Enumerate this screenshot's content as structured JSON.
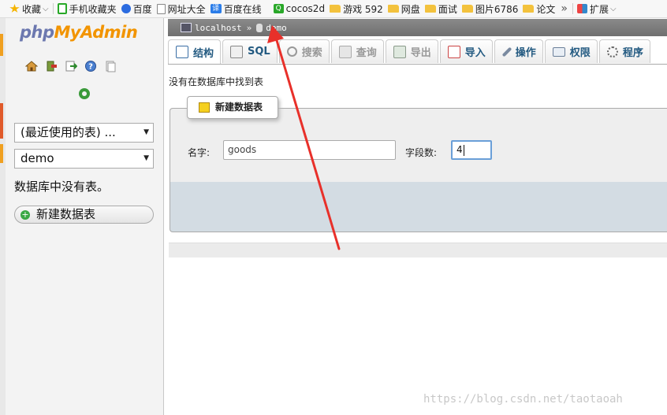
{
  "browser": {
    "bookmarks": [
      {
        "label": "收藏",
        "icon": "star-icon",
        "chevron": "⌵"
      },
      {
        "label": "手机收藏夹",
        "icon": "phone-icon"
      },
      {
        "label": "百度",
        "icon": "baidu-paw-icon"
      },
      {
        "label": "网址大全",
        "icon": "page-icon"
      },
      {
        "label": "百度在线",
        "icon": "translate-icon",
        "glyph": "译"
      },
      {
        "label": "cocos2d",
        "icon": "search-icon",
        "glyph": "Q"
      },
      {
        "label": "游戏 592",
        "icon": "folder-icon"
      },
      {
        "label": "网盘",
        "icon": "folder-icon"
      },
      {
        "label": "面试",
        "icon": "folder-icon"
      },
      {
        "label": "图片6786",
        "icon": "folder-icon"
      },
      {
        "label": "论文",
        "icon": "folder-icon"
      }
    ],
    "overflow": "»",
    "extensions_label": "扩展",
    "extensions_chevron": "⌵"
  },
  "sidebar": {
    "logo_php": "php",
    "logo_myadmin": "MyAdmin",
    "nav_icons": [
      "home-icon",
      "logout-icon",
      "sql-query-icon",
      "help-icon",
      "docs-icon"
    ],
    "reload_icon": "reload-icon",
    "recent_tables": "(最近使用的表) ...",
    "database_select": "demo",
    "no_tables_text": "数据库中没有表。",
    "new_table_button": "新建数据表",
    "new_table_glyph": "+"
  },
  "breadcrumb": {
    "server": "localhost",
    "separator": "»",
    "database": "demo"
  },
  "tabs": [
    {
      "label": "结构",
      "icon": "structure-icon",
      "state": "active"
    },
    {
      "label": "SQL",
      "icon": "sql-icon",
      "state": "normal"
    },
    {
      "label": "搜索",
      "icon": "search-icon",
      "state": "disabled"
    },
    {
      "label": "查询",
      "icon": "query-icon",
      "state": "disabled"
    },
    {
      "label": "导出",
      "icon": "export-icon",
      "state": "disabled"
    },
    {
      "label": "导入",
      "icon": "import-icon",
      "state": "normal"
    },
    {
      "label": "操作",
      "icon": "wrench-icon",
      "state": "normal"
    },
    {
      "label": "权限",
      "icon": "privileges-icon",
      "state": "normal"
    },
    {
      "label": "程序",
      "icon": "routines-icon",
      "state": "normal"
    }
  ],
  "main": {
    "message": "没有在数据库中找到表",
    "create_table_legend": "新建数据表",
    "name_label": "名字:",
    "name_value": "goods",
    "columns_label": "字段数:",
    "columns_value": "4"
  },
  "watermark": "https://blog.csdn.net/taotaoah",
  "colors": {
    "logo_php": "#6c78af",
    "logo_myadmin": "#f29400",
    "tab_text": "#235a81",
    "annotation_arrow": "#e8302a",
    "breadcrumb_bg": "#7d7d7d",
    "footer_bg": "#d3dce3"
  }
}
